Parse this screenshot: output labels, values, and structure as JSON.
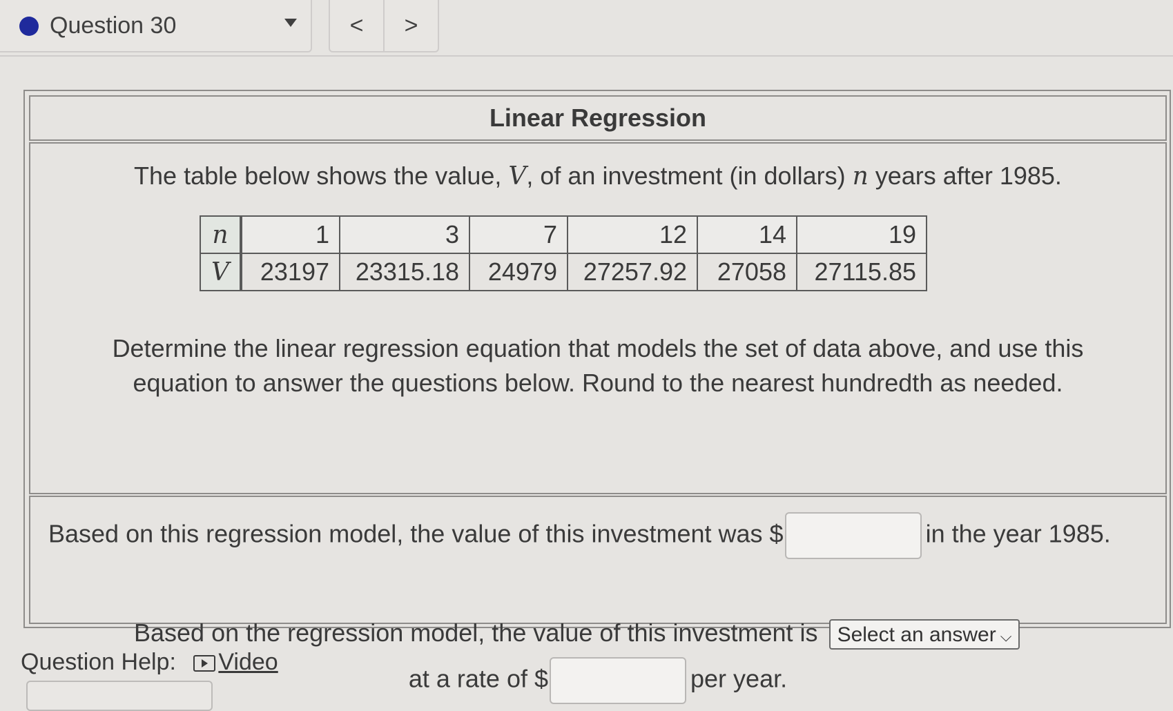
{
  "nav": {
    "question_label": "Question 30",
    "prev": "<",
    "next": ">",
    "status_color": "#1f2a9c"
  },
  "problem": {
    "title": "Linear Regression",
    "desc_pre": "The table below shows the value, ",
    "var_v": "V",
    "desc_mid": ", of an investment (in dollars) ",
    "var_n": "n",
    "desc_post": " years after 1985.",
    "table": {
      "row_n_label": "n",
      "row_v_label": "V",
      "n": [
        "1",
        "3",
        "7",
        "12",
        "14",
        "19"
      ],
      "v": [
        "23197",
        "23315.18",
        "24979",
        "27257.92",
        "27058",
        "27115.85"
      ]
    },
    "instructions_line1": "Determine the linear regression equation that models the set of data above, and use this",
    "instructions_line2": "equation to answer the questions below. Round to the nearest hundredth as needed."
  },
  "questions": {
    "q1_pre": "Based on this regression model, the value of this investment was $",
    "q1_post": "in the year 1985.",
    "q2_pre": "Based on the regression model, the value of this investment is",
    "select_value": "Select an answer",
    "q3_pre": "at a rate of $",
    "q3_post": "per year."
  },
  "help": {
    "label": "Question Help:",
    "video": "Video"
  }
}
